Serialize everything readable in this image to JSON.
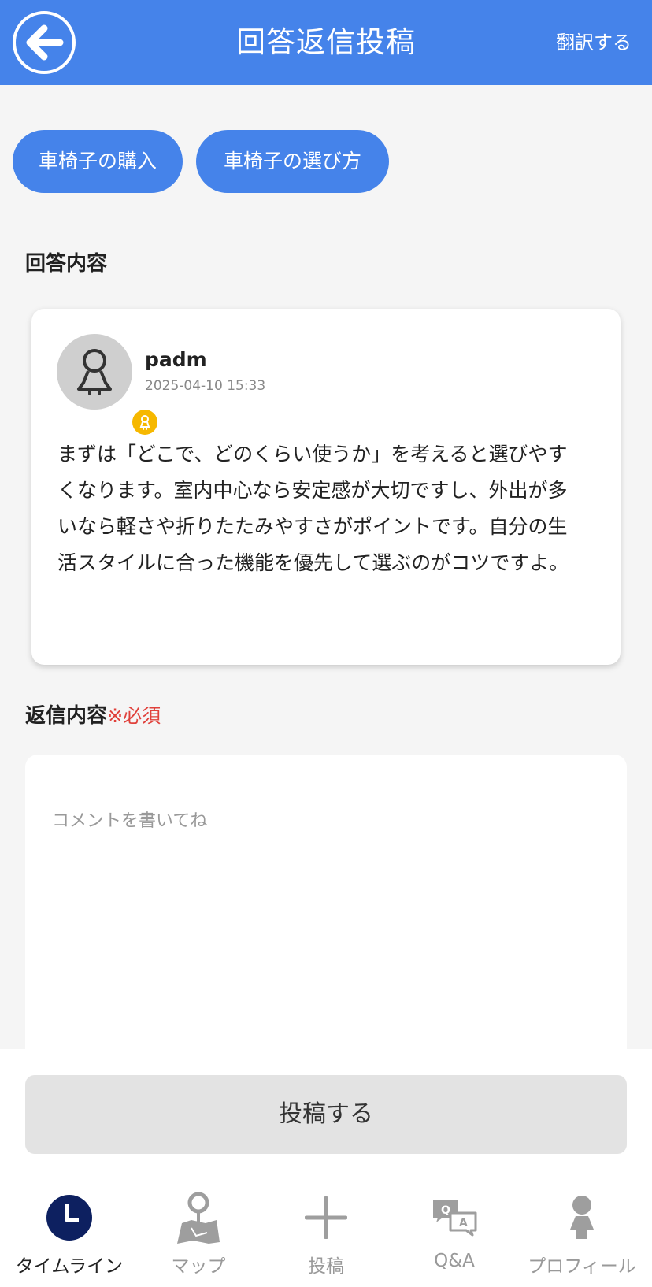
{
  "header": {
    "title": "回答返信投稿",
    "translate_label": "翻訳する",
    "accent_color": "#4583ea"
  },
  "tags": [
    {
      "label": "車椅子の購入"
    },
    {
      "label": "車椅子の選び方"
    }
  ],
  "answer_section": {
    "label": "回答内容",
    "card": {
      "username": "padm",
      "timestamp": "2025-04-10 15:33",
      "body": "まずは「どこで、どのくらい使うか」を考えると選びやすくなります。室内中心なら安定感が大切ですし、外出が多いなら軽さや折りたたみやすさがポイントです。自分の生活スタイルに合った機能を優先して選ぶのがコツですよ。"
    }
  },
  "reply_section": {
    "label": "返信内容",
    "required_label": "※必須",
    "placeholder": "コメントを書いてね",
    "value": ""
  },
  "submit_label": "投稿する",
  "nav": {
    "items": [
      {
        "label": "タイムライン",
        "icon": "clock-icon",
        "active": true
      },
      {
        "label": "マップ",
        "icon": "map-pin-icon",
        "active": false
      },
      {
        "label": "投稿",
        "icon": "plus-icon",
        "active": false
      },
      {
        "label": "Q&A",
        "icon": "qa-icon",
        "active": false
      },
      {
        "label": "プロフィール",
        "icon": "person-icon",
        "active": false
      }
    ]
  },
  "colors": {
    "required": "#e0413b",
    "nav_active_icon": "#0d2060"
  }
}
